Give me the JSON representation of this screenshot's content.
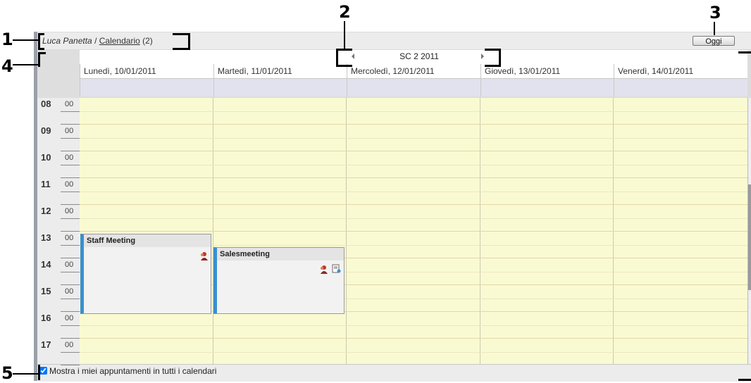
{
  "callouts": {
    "c1": "1",
    "c2": "2",
    "c3": "3",
    "c4": "4",
    "c5": "5"
  },
  "breadcrumb": {
    "owner": "Luca Panetta",
    "separator": " / ",
    "calendar": "Calendario",
    "count": " (2)"
  },
  "toolbar": {
    "today_label": "Oggi"
  },
  "week": {
    "label": "SC 2 2011"
  },
  "days": [
    "Lunedì, 10/01/2011",
    "Martedì, 11/01/2011",
    "Mercoledì, 12/01/2011",
    "Giovedì, 13/01/2011",
    "Venerdì, 14/01/2011"
  ],
  "hours": [
    "08",
    "09",
    "10",
    "11",
    "12",
    "13",
    "14",
    "15",
    "16",
    "17"
  ],
  "minute_label": "00",
  "appointments": [
    {
      "title": "Staff Meeting",
      "day": "Lunedì, 10/01/2011",
      "start": "13:00",
      "end": "16:00",
      "icons": [
        "participants-icon"
      ]
    },
    {
      "title": "Salesmeeting",
      "day": "Martedì, 11/01/2011",
      "start": "13:30",
      "end": "16:00",
      "icons": [
        "participants-icon",
        "notes-icon"
      ]
    }
  ],
  "footer": {
    "show_all_label": "Mostra i miei appuntamenti in tutti i calendari",
    "show_all_checked": true
  },
  "colors": {
    "grid_bg": "#fafad2",
    "appointment_accent": "#3a8fd0",
    "allday_bg": "#e2e2ee"
  }
}
